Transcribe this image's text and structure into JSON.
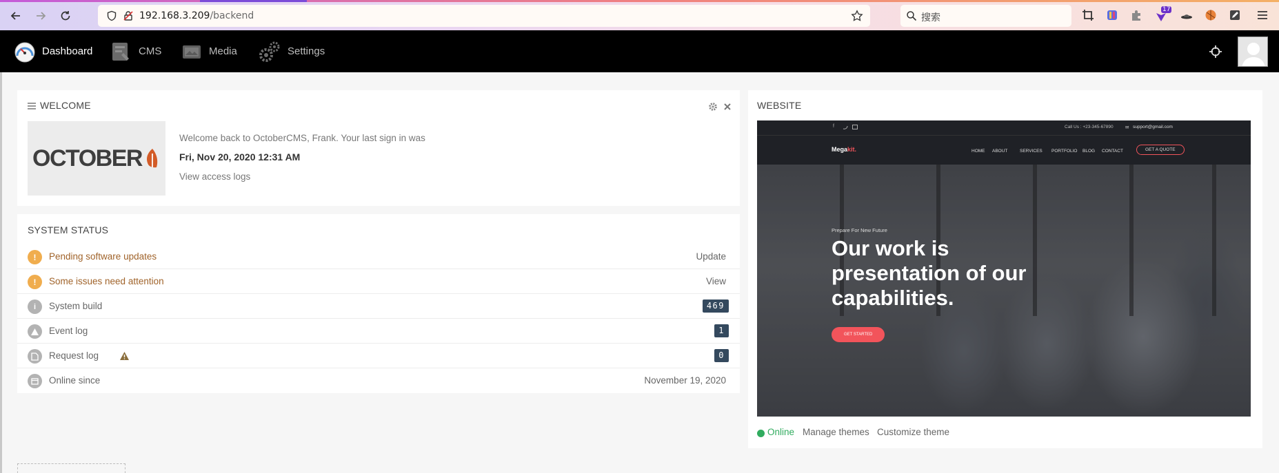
{
  "browser": {
    "url_host": "192.168.3.209",
    "url_path": "/backend",
    "search_placeholder": "搜索",
    "ext_badge": "17"
  },
  "nav": {
    "items": [
      {
        "label": "Dashboard",
        "icon": "dashboard-gauge-icon"
      },
      {
        "label": "CMS",
        "icon": "cms-icon"
      },
      {
        "label": "Media",
        "icon": "media-icon"
      },
      {
        "label": "Settings",
        "icon": "settings-gear-icon"
      }
    ]
  },
  "welcome": {
    "title": "WELCOME",
    "logo_text": "OCTOBER",
    "message": "Welcome back to OctoberCMS, Frank. Your last sign in was",
    "last_signin": "Fri, Nov 20, 2020 12:31 AM",
    "link": "View access logs"
  },
  "system_status": {
    "title": "SYSTEM STATUS",
    "rows": [
      {
        "label": "Pending software updates",
        "action": "Update",
        "type": "warning"
      },
      {
        "label": "Some issues need attention",
        "action": "View",
        "type": "warning"
      },
      {
        "label": "System build",
        "badge": "469",
        "type": "info"
      },
      {
        "label": "Event log",
        "badge": "1",
        "type": "event"
      },
      {
        "label": "Request log",
        "badge": "0",
        "type": "request"
      },
      {
        "label": "Online since",
        "action": "November 19, 2020",
        "type": "calendar"
      }
    ]
  },
  "website": {
    "title": "WEBSITE",
    "preview": {
      "call": "Call Us : +23-345-67890",
      "email": "support@gmail.com",
      "brand": "Mega",
      "brand_accent": "kit.",
      "menu": [
        "HOME",
        "ABOUT",
        "SERVICES",
        "PORTFOLIO",
        "BLOG",
        "CONTACT"
      ],
      "cta": "GET A QUOTE",
      "kicker": "Prepare For New Future",
      "headline_1": "Our work is",
      "headline_2": "presentation of our",
      "headline_3": "capabilities.",
      "button": "GET STARTED"
    },
    "status": "Online",
    "manage": "Manage themes",
    "customize": "Customize theme"
  },
  "colors": {
    "warning": "#f0ad4e",
    "grey_icon": "#b3b3b3",
    "online": "#31ac5f",
    "accent_red": "#f2545b",
    "badge_bg": "#34495e"
  }
}
